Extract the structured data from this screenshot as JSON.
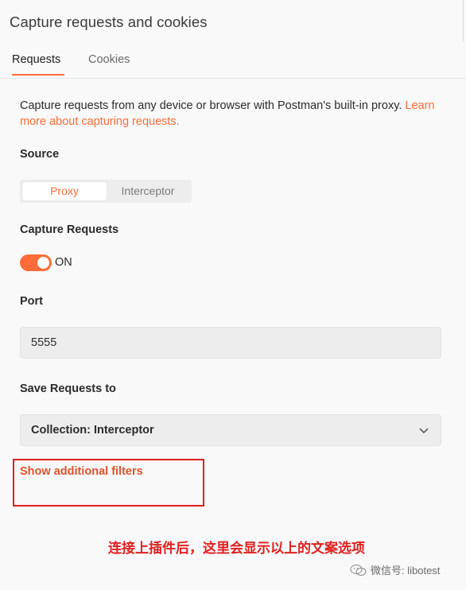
{
  "window": {
    "title": "Capture requests and cookies"
  },
  "tabs": [
    {
      "label": "Requests",
      "active": true
    },
    {
      "label": "Cookies",
      "active": false
    }
  ],
  "description": {
    "text": "Capture requests from any device or browser with Postman's built-in proxy.",
    "link": "Learn more about capturing requests."
  },
  "source": {
    "label": "Source",
    "options": [
      "Proxy",
      "Interceptor"
    ],
    "selected": "Proxy"
  },
  "capture": {
    "label": "Capture Requests",
    "toggle_state": "ON"
  },
  "port": {
    "label": "Port",
    "value": "5555"
  },
  "save": {
    "label": "Save Requests to",
    "value": "Collection: Interceptor"
  },
  "filters": {
    "link": "Show additional filters"
  },
  "annotation": {
    "text": "连接上插件后，这里会显示以上的文案选项"
  },
  "watermark": {
    "text": "微信号: libotest",
    "icon": "wechat-icon"
  },
  "colors": {
    "accent": "#ff6c37",
    "annotation": "#e02020"
  }
}
